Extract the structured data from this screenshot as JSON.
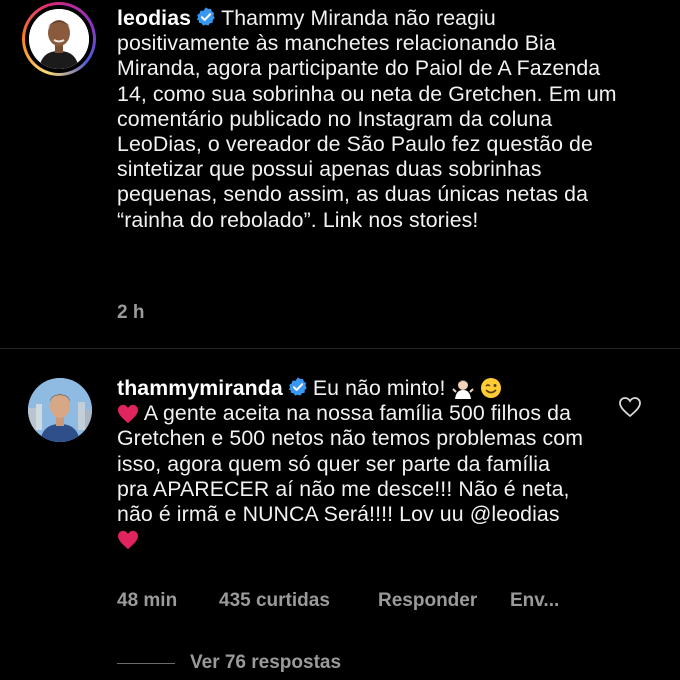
{
  "post": {
    "username": "leodias",
    "caption": "Thammy Miranda não reagiu positivamente às manchetes relacionando Bia Miranda, agora participante do Paiol de A Fazenda 14, como sua sobrinha ou neta de Gretchen. Em um comentário publicado no Instagram da coluna LeoDias, o vereador de São Paulo fez questão de sintetizar que possui apenas duas sobrinhas pequenas, sendo assim, as duas únicas netas da “rainha do rebolado”. Link nos stories!",
    "time": "2 h"
  },
  "comment": {
    "username": "thammymiranda",
    "text_part1": "Eu não minto!",
    "text_part2": "A gente aceita na nossa família 500 filhos da Gretchen e 500 netos não temos problemas com isso, agora quem só quer ser parte da família pra APARECER aí não me desce!!! Não é neta, não é irmã e NUNCA Será!!!! Lov uu @leodias",
    "time": "48 min",
    "likes": "435 curtidas",
    "reply_label": "Responder",
    "send_label": "Env...",
    "view_replies": "Ver 76 respostas"
  },
  "colors": {
    "background": "#000000",
    "text": "#f2f2f2",
    "meta": "#9a9a9a",
    "verified": "#3897f0",
    "heart_emoji": "#e0245e"
  },
  "icons": {
    "verified": "verified-badge-icon",
    "like": "heart-outline-icon"
  }
}
